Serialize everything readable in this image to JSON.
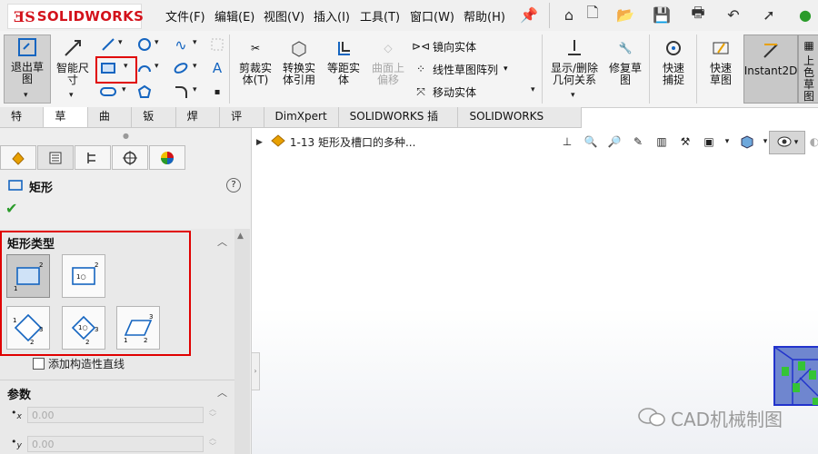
{
  "logo": {
    "text": "SOLIDWORKS"
  },
  "menu": [
    "文件(F)",
    "编辑(E)",
    "视图(V)",
    "插入(I)",
    "工具(T)",
    "窗口(W)",
    "帮助(H)"
  ],
  "ribbon": {
    "exit_sketch": "退出草图",
    "smart_dim": "智能尺寸",
    "trim": "剪裁实体(T)",
    "convert": "转换实体引用",
    "offset": "等距实体",
    "offset_surface": "曲面上偏移",
    "mirror": "镜向实体",
    "linear_pattern": "线性草图阵列",
    "move": "移动实体",
    "display_relations": "显示/删除几何关系",
    "repair": "修复草图",
    "snap": "快速捕捉",
    "rapid": "快速草图",
    "instant2d": "Instant2D",
    "clipped": "上色草图"
  },
  "tabs": [
    "特征",
    "草图",
    "曲面",
    "钣金",
    "焊件",
    "评估",
    "DimXpert",
    "SOLIDWORKS 插件",
    "SOLIDWORKS MBD"
  ],
  "active_tab": "草图",
  "panel": {
    "title": "矩形",
    "section_type": "矩形类型",
    "construction": "添加构造性直线",
    "section_params": "参数",
    "x_label": "x",
    "y_label": "y",
    "x_value": "0.00",
    "y_value": "0.00",
    "help": "?"
  },
  "tree": {
    "label": "1-13 矩形及槽口的多种..."
  },
  "watermark": "CAD机械制图",
  "colors": {
    "accent_red": "#e00000",
    "logo_red": "#d3121b"
  }
}
